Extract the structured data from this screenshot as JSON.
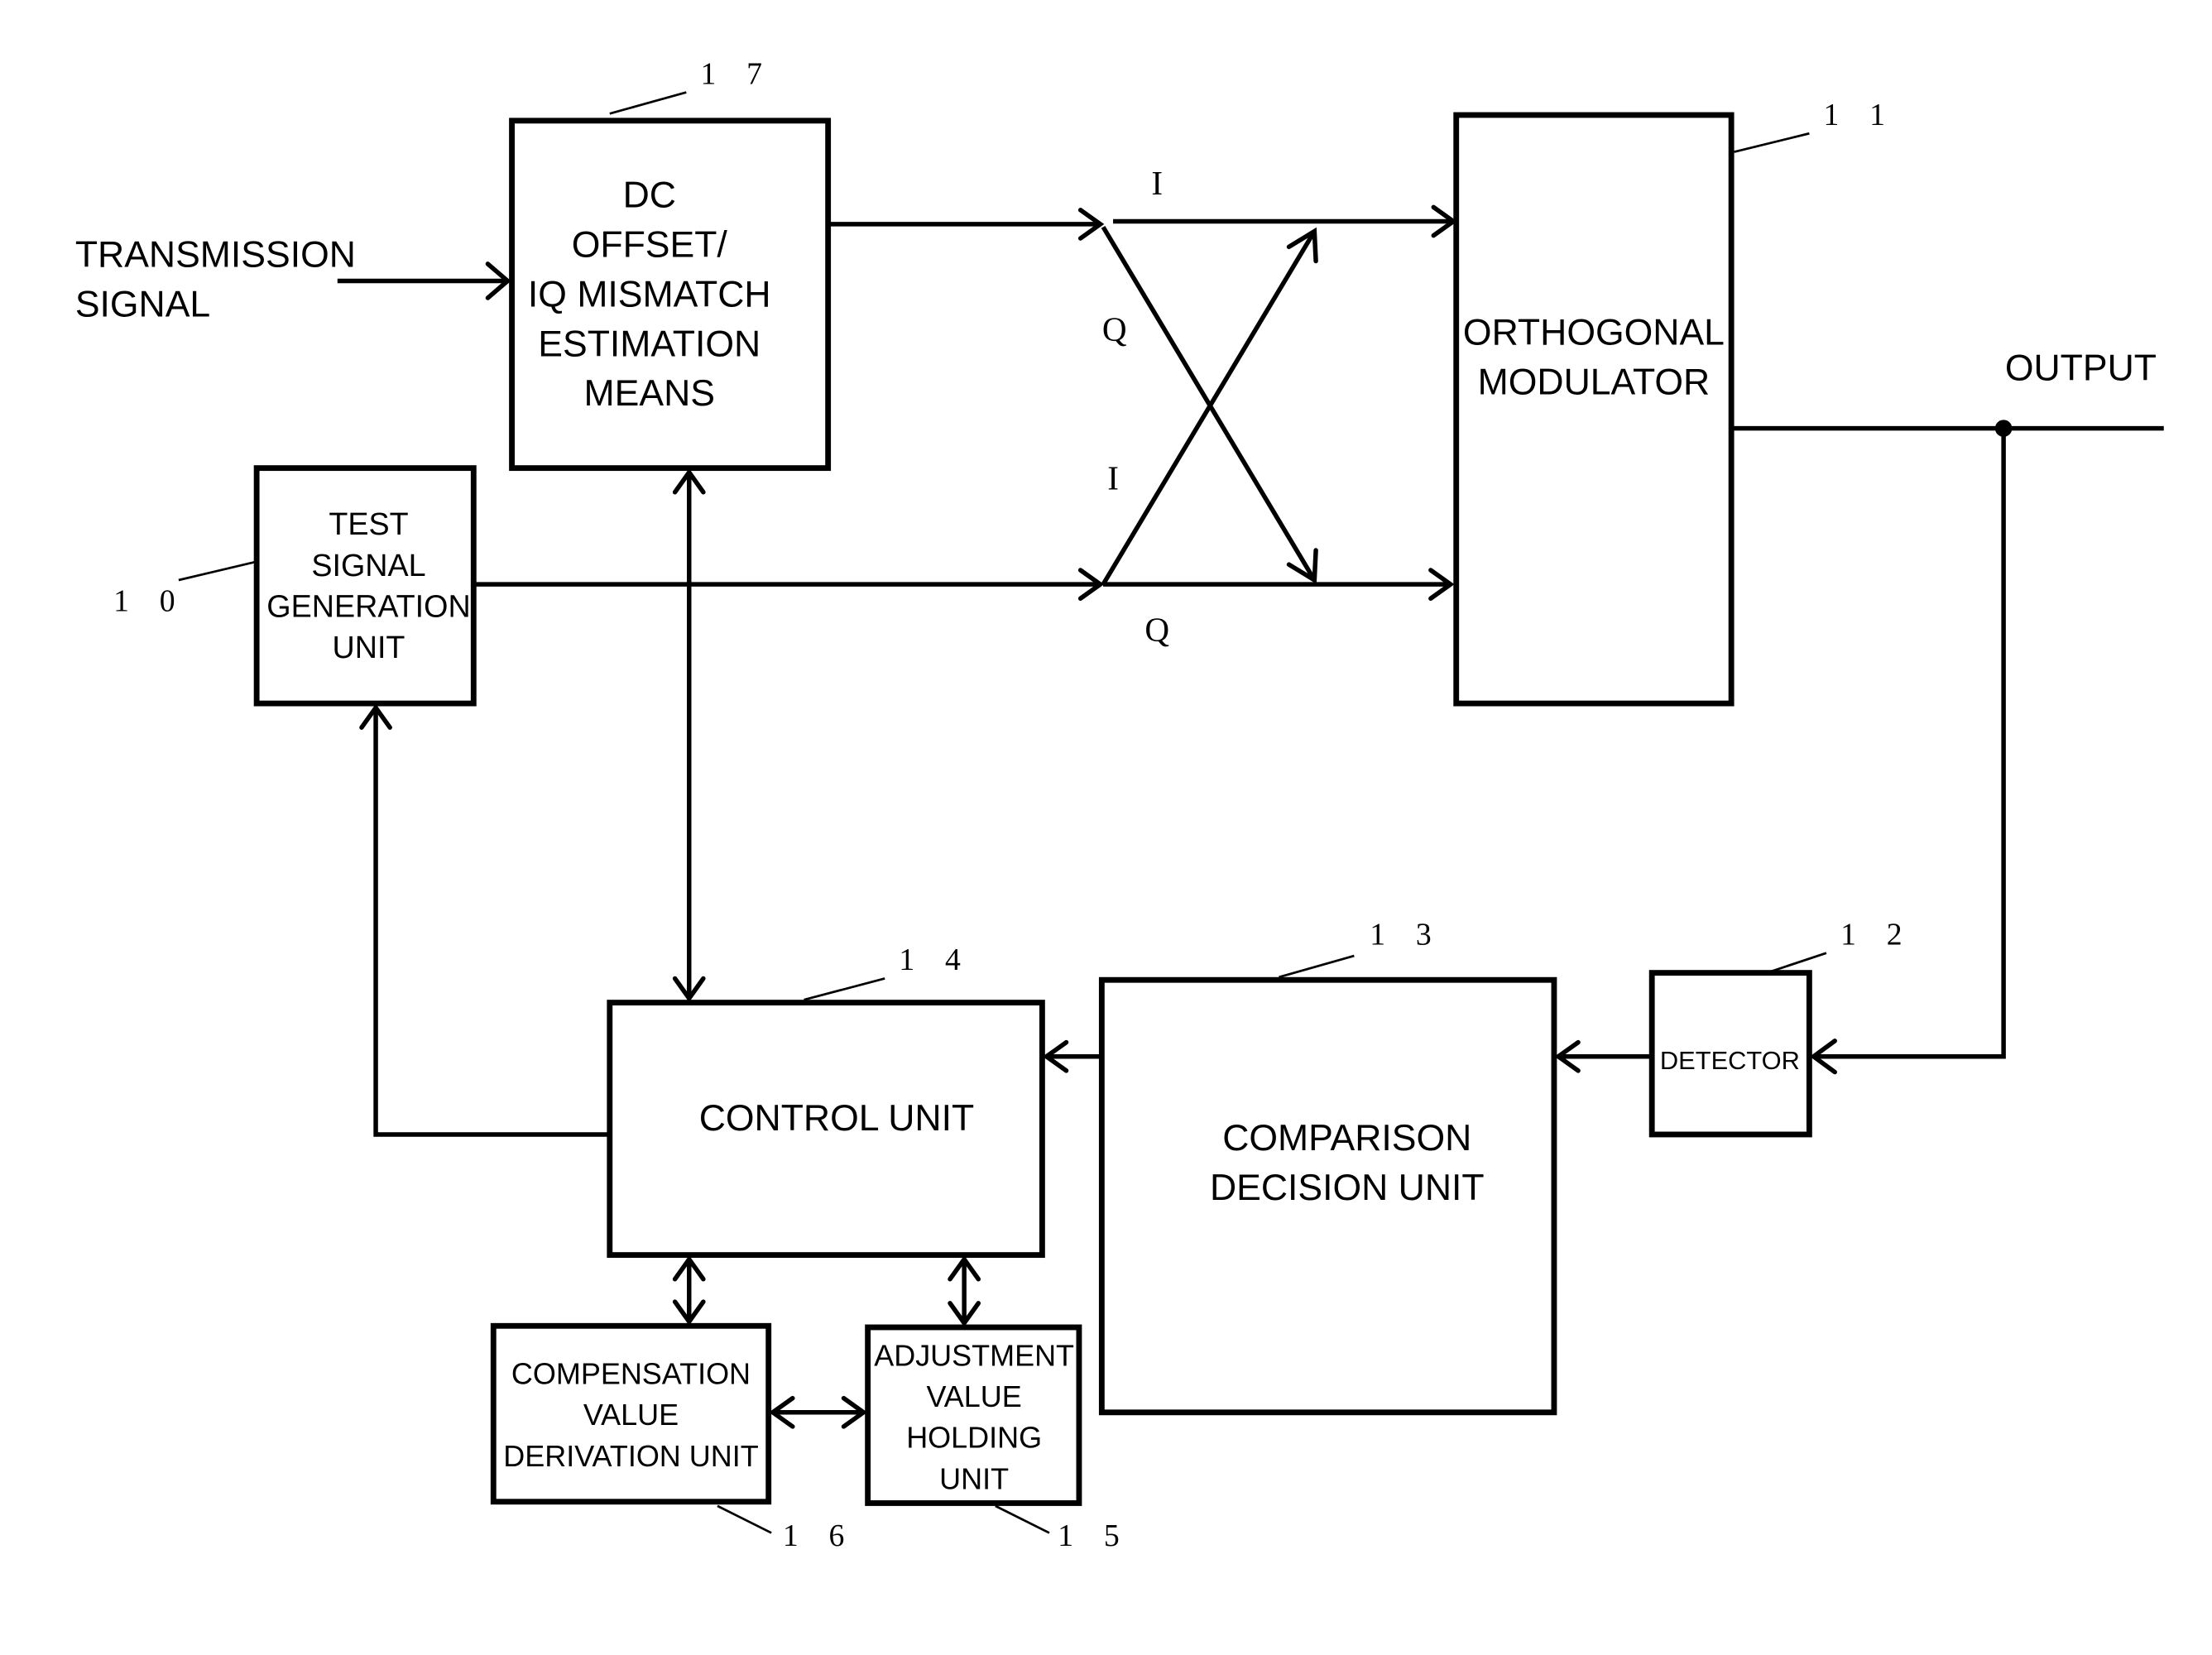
{
  "diagram": {
    "inputs": {
      "transmission_signal": [
        "TRANSMISSION",
        "SIGNAL"
      ],
      "output": "OUTPUT"
    },
    "blocks": {
      "dc_offset_estimation": {
        "ref": "1 7",
        "lines": [
          "DC",
          "OFFSET/",
          "IQ MISMATCH",
          "ESTIMATION",
          "MEANS"
        ]
      },
      "test_signal_generation": {
        "ref": "1 0",
        "lines": [
          "TEST",
          "SIGNAL",
          "GENERATION",
          "UNIT"
        ]
      },
      "orthogonal_modulator": {
        "ref": "1 1",
        "lines": [
          "ORTHOGONAL",
          "MODULATOR"
        ]
      },
      "detector": {
        "ref": "1 2",
        "lines": [
          "DETECTOR"
        ]
      },
      "comparison_decision": {
        "ref": "1 3",
        "lines": [
          "COMPARISON",
          "DECISION UNIT"
        ]
      },
      "control_unit": {
        "ref": "1 4",
        "lines": [
          "CONTROL UNIT"
        ]
      },
      "adjustment_value_holding": {
        "ref": "1 5",
        "lines": [
          "ADJUSTMENT",
          "VALUE",
          "HOLDING",
          "UNIT"
        ]
      },
      "compensation_value_derivation": {
        "ref": "1 6",
        "lines": [
          "COMPENSATION",
          "VALUE",
          "DERIVATION UNIT"
        ]
      }
    },
    "signal_labels": {
      "top_straight": "I",
      "top_cross": "Q",
      "bottom_cross": "I",
      "bottom_straight": "Q"
    }
  }
}
